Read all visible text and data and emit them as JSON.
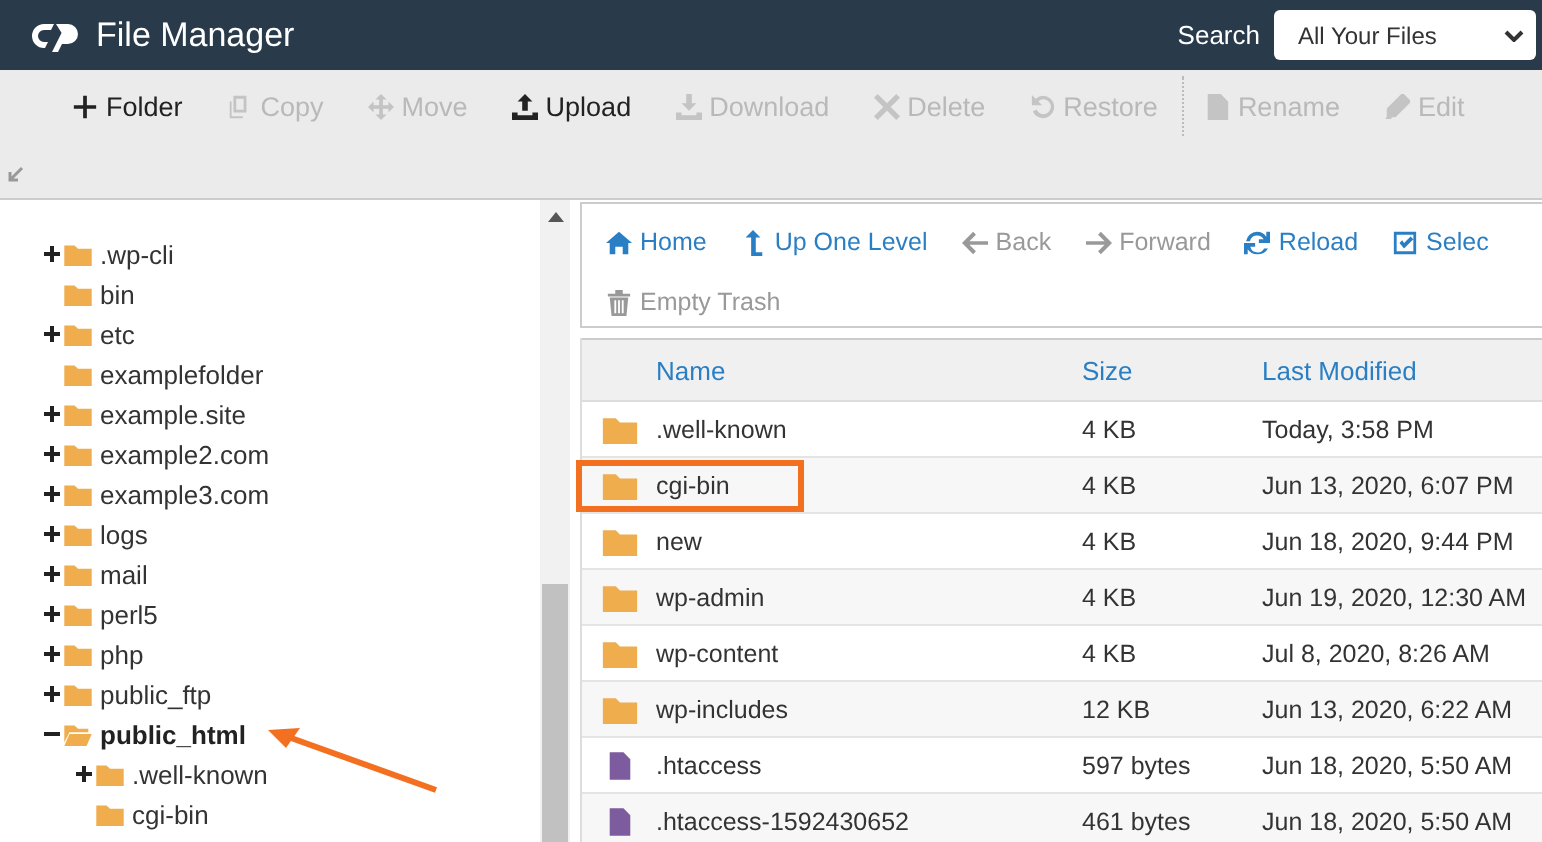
{
  "header": {
    "title": "File Manager",
    "search_label": "Search",
    "search_scope": "All Your Files"
  },
  "toolbar": [
    {
      "kind": "new-folder",
      "label": "Folder",
      "disabled": false
    },
    {
      "kind": "copy",
      "label": "Copy",
      "disabled": true
    },
    {
      "kind": "move",
      "label": "Move",
      "disabled": true
    },
    {
      "kind": "upload",
      "label": "Upload",
      "disabled": false
    },
    {
      "kind": "download",
      "label": "Download",
      "disabled": true
    },
    {
      "kind": "delete",
      "label": "Delete",
      "disabled": true
    },
    {
      "kind": "restore",
      "label": "Restore",
      "disabled": true
    },
    {
      "kind": "rename",
      "label": "Rename",
      "disabled": true
    },
    {
      "kind": "edit",
      "label": "Edit",
      "disabled": true
    }
  ],
  "tree": [
    {
      "label": ".wp-cli",
      "kind": "collapsed",
      "selected": false
    },
    {
      "label": "bin",
      "kind": "leaf",
      "selected": false
    },
    {
      "label": "etc",
      "kind": "collapsed",
      "selected": false
    },
    {
      "label": "examplefolder",
      "kind": "leaf",
      "selected": false
    },
    {
      "label": "example.site",
      "kind": "collapsed",
      "selected": false
    },
    {
      "label": "example2.com",
      "kind": "collapsed",
      "selected": false
    },
    {
      "label": "example3.com",
      "kind": "collapsed",
      "selected": false
    },
    {
      "label": "logs",
      "kind": "collapsed",
      "selected": false
    },
    {
      "label": "mail",
      "kind": "collapsed",
      "selected": false
    },
    {
      "label": "perl5",
      "kind": "collapsed",
      "selected": false
    },
    {
      "label": "php",
      "kind": "collapsed",
      "selected": false
    },
    {
      "label": "public_ftp",
      "kind": "collapsed",
      "selected": false
    },
    {
      "label": "public_html",
      "kind": "expanded",
      "selected": true,
      "annotated": true,
      "children": [
        {
          "label": ".well-known",
          "kind": "collapsed",
          "selected": false
        },
        {
          "label": "cgi-bin",
          "kind": "leaf",
          "selected": false
        }
      ]
    }
  ],
  "nav": [
    {
      "kind": "home",
      "label": "Home",
      "disabled": false
    },
    {
      "kind": "up",
      "label": "Up One Level",
      "disabled": false
    },
    {
      "kind": "back",
      "label": "Back",
      "disabled": true
    },
    {
      "kind": "forward",
      "label": "Forward",
      "disabled": true
    },
    {
      "kind": "reload",
      "label": "Reload",
      "disabled": false
    },
    {
      "kind": "select",
      "label": "Selec",
      "disabled": false
    },
    {
      "kind": "trash",
      "label": "Empty Trash",
      "disabled": true
    }
  ],
  "table": {
    "columns": [
      "Name",
      "Size",
      "Last Modified"
    ],
    "rows": [
      {
        "kind": "folder",
        "name": ".well-known",
        "size": "4 KB",
        "modified": "Today, 3:58 PM",
        "highlighted": false
      },
      {
        "kind": "folder",
        "name": "cgi-bin",
        "size": "4 KB",
        "modified": "Jun 13, 2020, 6:07 PM",
        "highlighted": true
      },
      {
        "kind": "folder",
        "name": "new",
        "size": "4 KB",
        "modified": "Jun 18, 2020, 9:44 PM",
        "highlighted": false
      },
      {
        "kind": "folder",
        "name": "wp-admin",
        "size": "4 KB",
        "modified": "Jun 19, 2020, 12:30 AM",
        "highlighted": false
      },
      {
        "kind": "folder",
        "name": "wp-content",
        "size": "4 KB",
        "modified": "Jul 8, 2020, 8:26 AM",
        "highlighted": false
      },
      {
        "kind": "folder",
        "name": "wp-includes",
        "size": "12 KB",
        "modified": "Jun 13, 2020, 6:22 AM",
        "highlighted": false
      },
      {
        "kind": "file",
        "name": ".htaccess",
        "size": "597 bytes",
        "modified": "Jun 18, 2020, 5:50 AM",
        "highlighted": false
      },
      {
        "kind": "file",
        "name": ".htaccess-1592430652",
        "size": "461 bytes",
        "modified": "Jun 18, 2020, 5:50 AM",
        "highlighted": false
      }
    ]
  }
}
